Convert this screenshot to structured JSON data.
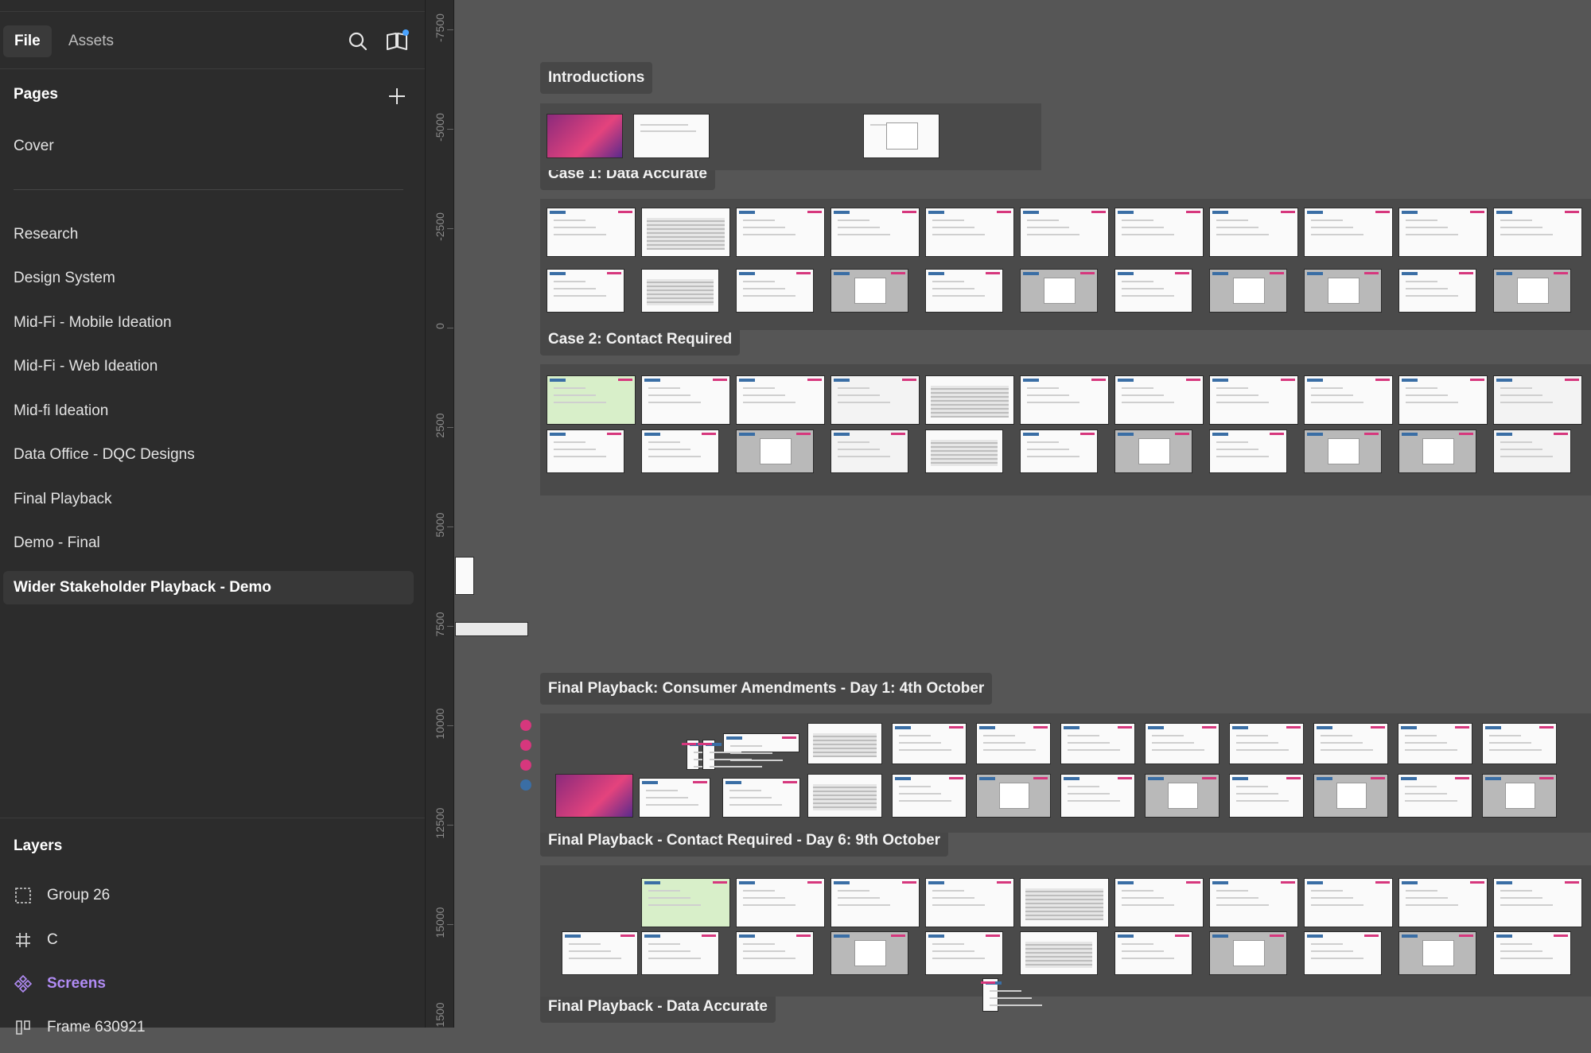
{
  "sidebar": {
    "tabs": {
      "file": "File",
      "assets": "Assets"
    },
    "icons": {
      "search": "search-icon",
      "library": "library-book-icon",
      "add_page": "plus-icon"
    },
    "pages_heading": "Pages",
    "pages": [
      "Cover",
      "Research",
      "Design System",
      "Mid-Fi - Mobile Ideation",
      "Mid-Fi - Web Ideation",
      "Mid-fi Ideation",
      "Data Office - DQC Designs",
      "Final Playback",
      "Demo - Final",
      "Wider Stakeholder Playback - Demo"
    ],
    "selected_page": "Wider Stakeholder Playback - Demo",
    "layers_heading": "Layers",
    "layers": [
      {
        "name": "Group 26",
        "icon": "group-dashed-icon"
      },
      {
        "name": "C",
        "icon": "frame-hash-icon"
      },
      {
        "name": "Screens",
        "icon": "component-icon"
      },
      {
        "name": "Frame 630921",
        "icon": "auto-layout-icon"
      }
    ]
  },
  "ruler": {
    "labels": [
      "-7500",
      "-5000",
      "-2500",
      "0",
      "2500",
      "5000",
      "7500",
      "10000",
      "12500",
      "15000",
      "1500"
    ]
  },
  "canvas": {
    "sections": [
      "Introductions",
      "Case 1: Data Accurate",
      "Case 2: Contact Required",
      "Final Playback: Consumer Amendments - Day 1: 4th October",
      "Final Playback - Contact Required - Day 6: 9th October",
      "Final Playback - Data Accurate"
    ]
  },
  "colors": {
    "sidebar_bg": "#2c2c2c",
    "canvas_bg": "#565656",
    "component_purple": "#b18cf5",
    "accent_pink": "#d6377d",
    "accent_blue": "#3a6ea5"
  }
}
